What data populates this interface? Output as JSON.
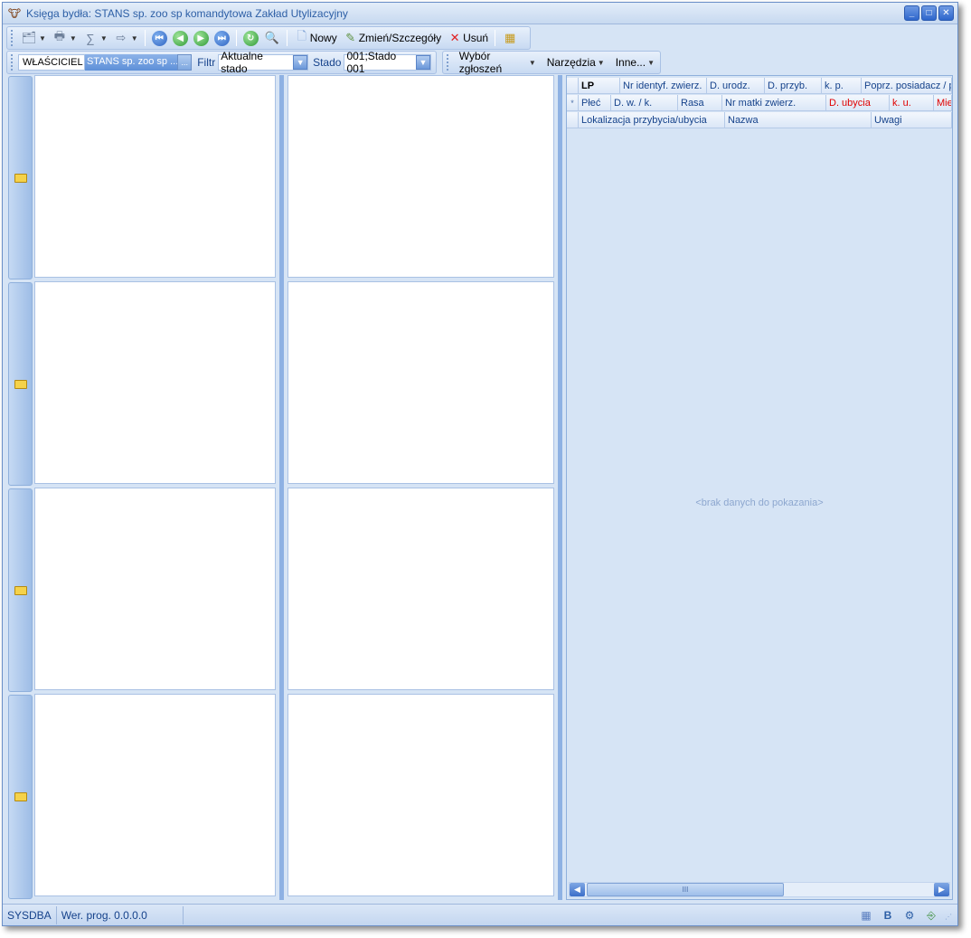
{
  "window": {
    "title": "Księga bydła: STANS sp. zoo sp komandytowa Zakład Utylizacyjny",
    "controls": [
      "_",
      "□",
      "✕"
    ]
  },
  "toolbar": {
    "new_label": "Nowy",
    "edit_label": "Zmień/Szczegóły",
    "delete_label": "Usuń"
  },
  "filterbar": {
    "owner_label": "WŁAŚCICIEL",
    "owner_value": "STANS sp. zoo sp ...",
    "ellipsis": "...",
    "filter_label": "Filtr",
    "filter_value": "Aktualne stado",
    "herd_label": "Stado",
    "herd_value": "001;Stado 001"
  },
  "menus": {
    "reports": "Wybór zgłoszeń",
    "tools": "Narzędzia",
    "other": "Inne..."
  },
  "grid": {
    "header_row1": [
      {
        "text": "LP",
        "style": "bold"
      },
      {
        "text": "Nr identyf. zwierz.",
        "style": ""
      },
      {
        "text": "D. urodz.",
        "style": ""
      },
      {
        "text": "D. przyb.",
        "style": ""
      },
      {
        "text": "k. p.",
        "style": ""
      },
      {
        "text": "Poprz. posiadacz / p",
        "style": ""
      }
    ],
    "header_row2": [
      {
        "text": "Płeć",
        "style": ""
      },
      {
        "text": "D. w. / k.",
        "style": ""
      },
      {
        "text": "Rasa",
        "style": ""
      },
      {
        "text": "Nr matki zwierz.",
        "style": ""
      },
      {
        "text": "D. ubycia",
        "style": "red"
      },
      {
        "text": "k. u.",
        "style": "red"
      },
      {
        "text": "Mie",
        "style": "red"
      }
    ],
    "header_row3": [
      {
        "text": "Lokalizacja przybycia/ubycia",
        "style": ""
      },
      {
        "text": "Nazwa",
        "style": ""
      },
      {
        "text": "Uwagi",
        "style": ""
      }
    ],
    "new_row_indicator": "*",
    "empty_message": "<brak danych do pokazania>",
    "scroll_thumb": "III"
  },
  "status": {
    "user": "SYSDBA",
    "version": "Wer. prog. 0.0.0.0"
  }
}
